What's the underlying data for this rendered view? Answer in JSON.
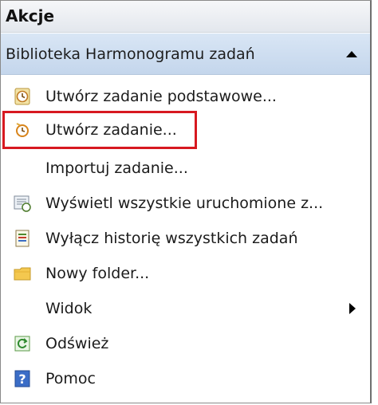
{
  "panel": {
    "title": "Akcje"
  },
  "section": {
    "title": "Biblioteka Harmonogramu zadań"
  },
  "items": [
    {
      "label": "Utwórz zadanie podstawowe...",
      "icon": "basic-task-icon"
    },
    {
      "label": "Utwórz zadanie...",
      "icon": "create-task-icon"
    },
    {
      "label": "Importuj zadanie...",
      "icon": ""
    },
    {
      "label": "Wyświetl wszystkie uruchomione z...",
      "icon": "running-tasks-icon"
    },
    {
      "label": "Wyłącz historię wszystkich zadań",
      "icon": "history-icon"
    },
    {
      "label": "Nowy folder...",
      "icon": "folder-icon"
    },
    {
      "label": "Widok",
      "icon": "",
      "submenu": true
    },
    {
      "label": "Odśwież",
      "icon": "refresh-icon"
    },
    {
      "label": "Pomoc",
      "icon": "help-icon"
    }
  ],
  "colors": {
    "highlight": "#d71920",
    "header": "#c9daee"
  }
}
